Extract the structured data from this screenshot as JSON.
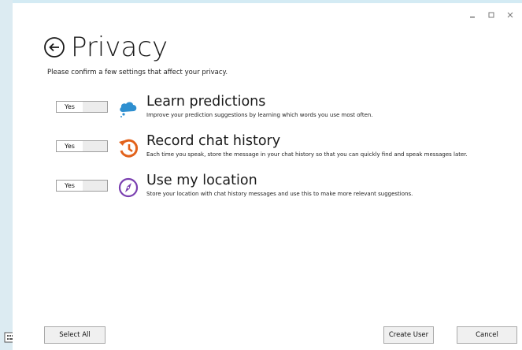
{
  "window": {
    "minimize_icon": "minimize-icon",
    "maximize_icon": "maximize-icon",
    "close_icon": "close-icon"
  },
  "header": {
    "title": "Privacy",
    "subtitle": "Please confirm a few settings that affect your privacy."
  },
  "settings": [
    {
      "toggle_label": "Yes",
      "title": "Learn predictions",
      "description": "Improve your prediction suggestions by learning which words you use most often.",
      "icon": "cloud-brain-icon"
    },
    {
      "toggle_label": "Yes",
      "title": "Record chat history",
      "description": "Each time you speak, store the message in your chat history so that you can quickly find and speak messages later.",
      "icon": "history-icon"
    },
    {
      "toggle_label": "Yes",
      "title": "Use my location",
      "description": "Store your location with chat history messages and use this to make more relevant suggestions.",
      "icon": "compass-icon"
    }
  ],
  "buttons": {
    "select_all": "Select All",
    "create_user": "Create User",
    "cancel": "Cancel"
  },
  "colors": {
    "background": "#d4ebf4",
    "cloud_icon": "#2e8fd0",
    "history_icon": "#e2621b",
    "compass_icon": "#7a3fb0"
  }
}
